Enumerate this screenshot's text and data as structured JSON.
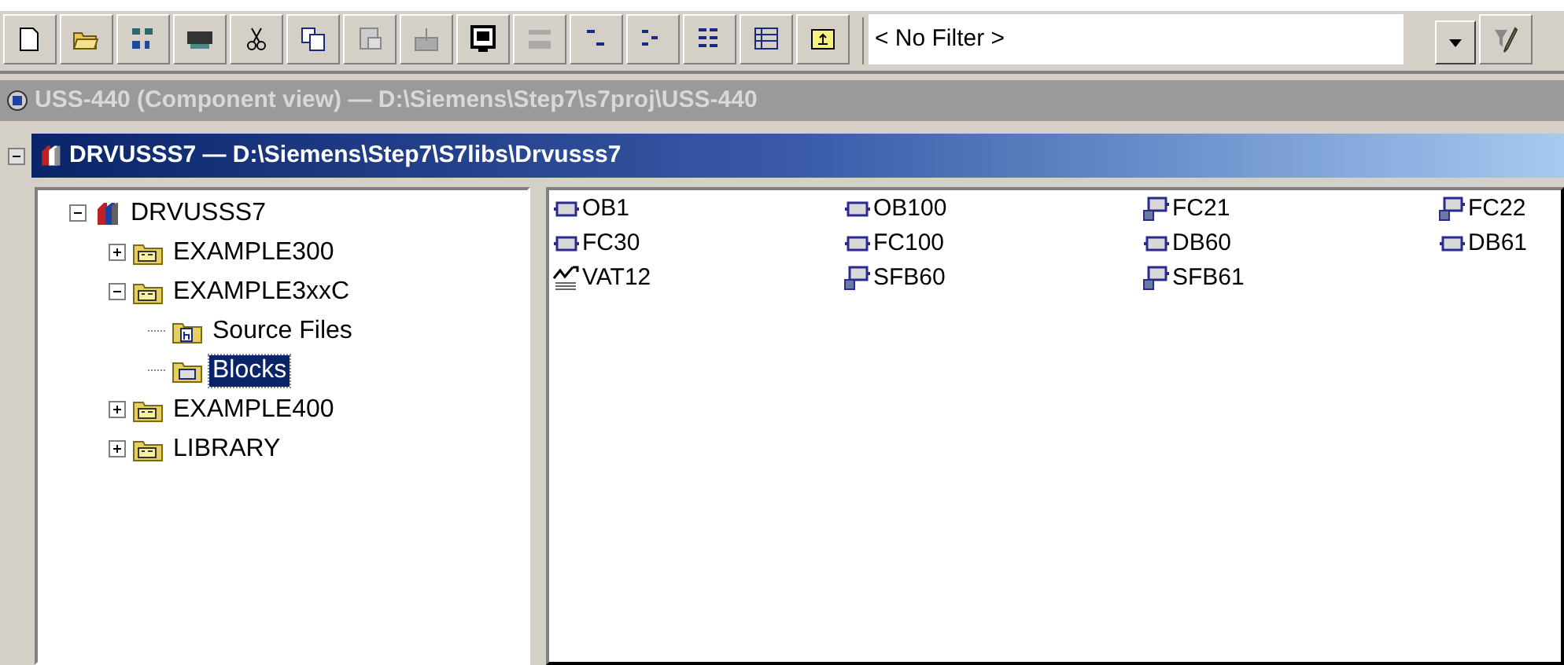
{
  "toolbar": {
    "buttons": [
      {
        "kind": "new"
      },
      {
        "kind": "open"
      },
      {
        "kind": "network"
      },
      {
        "kind": "module"
      },
      {
        "kind": "cut"
      },
      {
        "kind": "copy"
      },
      {
        "kind": "paste"
      },
      {
        "kind": "download"
      },
      {
        "kind": "online"
      },
      {
        "kind": "offline"
      },
      {
        "kind": "icons"
      },
      {
        "kind": "tree"
      },
      {
        "kind": "list"
      },
      {
        "kind": "details"
      },
      {
        "kind": "up"
      }
    ],
    "filter": {
      "value": "< No Filter >"
    }
  },
  "background_window": {
    "title": "USS-440 (Component view) — D:\\Siemens\\Step7\\s7proj\\USS-440"
  },
  "active_window": {
    "title": "DRVUSSS7 — D:\\Siemens\\Step7\\S7libs\\Drvusss7"
  },
  "tree": [
    {
      "label": "DRVUSSS7",
      "kind": "project",
      "expanded": true,
      "selected": false,
      "children": [
        {
          "label": "EXAMPLE300",
          "kind": "program",
          "expanded": false,
          "selected": false
        },
        {
          "label": "EXAMPLE3xxC",
          "kind": "program",
          "expanded": true,
          "selected": false,
          "children": [
            {
              "label": "Source Files",
              "kind": "sources",
              "selected": false
            },
            {
              "label": "Blocks",
              "kind": "blocks",
              "selected": true
            }
          ]
        },
        {
          "label": "EXAMPLE400",
          "kind": "program",
          "expanded": false,
          "selected": false
        },
        {
          "label": "LIBRARY",
          "kind": "program",
          "expanded": false,
          "selected": false
        }
      ]
    }
  ],
  "blocks": [
    {
      "name": "OB1",
      "kind": "block"
    },
    {
      "name": "OB100",
      "kind": "block"
    },
    {
      "name": "FC21",
      "kind": "function"
    },
    {
      "name": "FC22",
      "kind": "function"
    },
    {
      "name": "FC30",
      "kind": "block"
    },
    {
      "name": "FC100",
      "kind": "block"
    },
    {
      "name": "DB60",
      "kind": "block"
    },
    {
      "name": "DB61",
      "kind": "block"
    },
    {
      "name": "VAT12",
      "kind": "table"
    },
    {
      "name": "SFB60",
      "kind": "function"
    },
    {
      "name": "SFB61",
      "kind": "function"
    }
  ]
}
